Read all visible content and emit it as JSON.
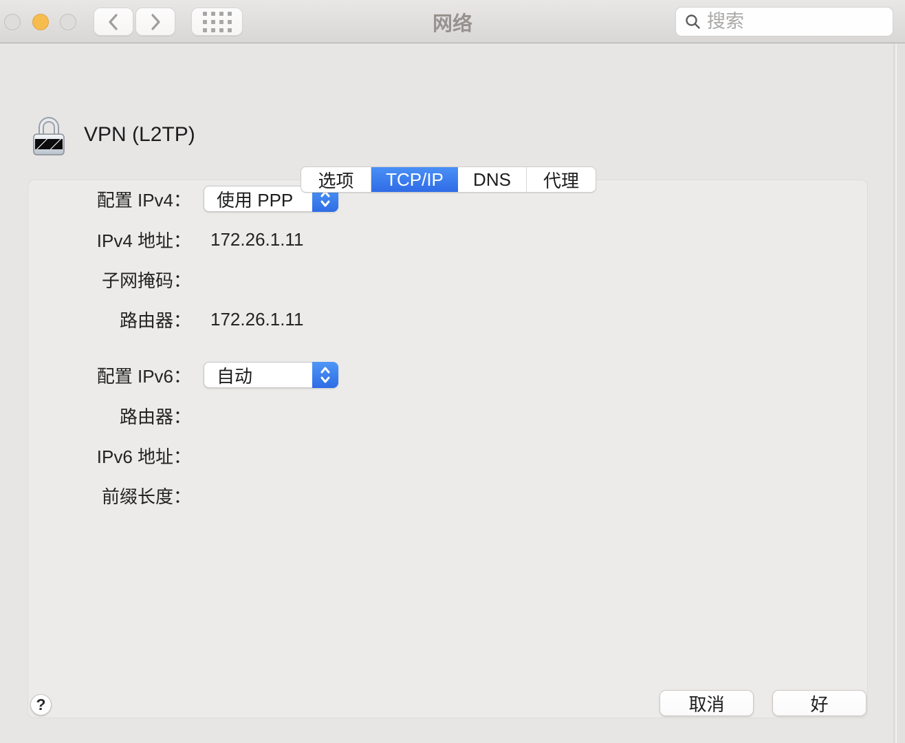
{
  "window": {
    "title": "网络",
    "search_placeholder": "搜索"
  },
  "header": {
    "connection_name": "VPN (L2TP)"
  },
  "tabs": [
    {
      "label": "选项",
      "selected": false
    },
    {
      "label": "TCP/IP",
      "selected": true
    },
    {
      "label": "DNS",
      "selected": false
    },
    {
      "label": "代理",
      "selected": false
    }
  ],
  "form": {
    "ipv4": {
      "configure_label": "配置 IPv4：",
      "configure_value": "使用 PPP",
      "address_label": "IPv4 地址：",
      "address_value": "172.26.1.11",
      "subnet_label": "子网掩码：",
      "subnet_value": "",
      "router_label": "路由器：",
      "router_value": "172.26.1.11"
    },
    "ipv6": {
      "configure_label": "配置 IPv6：",
      "configure_value": "自动",
      "router_label": "路由器：",
      "router_value": "",
      "address_label": "IPv6 地址：",
      "address_value": "",
      "prefix_label": "前缀长度：",
      "prefix_value": ""
    }
  },
  "footer": {
    "help_label": "?",
    "cancel_label": "取消",
    "ok_label": "好"
  },
  "icons": {
    "traffic_lights": [
      "close-disabled",
      "minimize",
      "zoom-disabled"
    ],
    "back": "chevron-left",
    "forward": "chevron-right",
    "show_all": "grid-of-dots",
    "search": "magnifier",
    "connection": "padlock-striped",
    "select_stepper": "chevron-up-down",
    "help": "question-mark"
  },
  "colors": {
    "accent_blue": "#3a7df0",
    "traffic_yellow": "#f6bd4e",
    "panel_bg": "#ecebea",
    "page_bg": "#e7e6e5",
    "title_gray": "#97928f"
  }
}
